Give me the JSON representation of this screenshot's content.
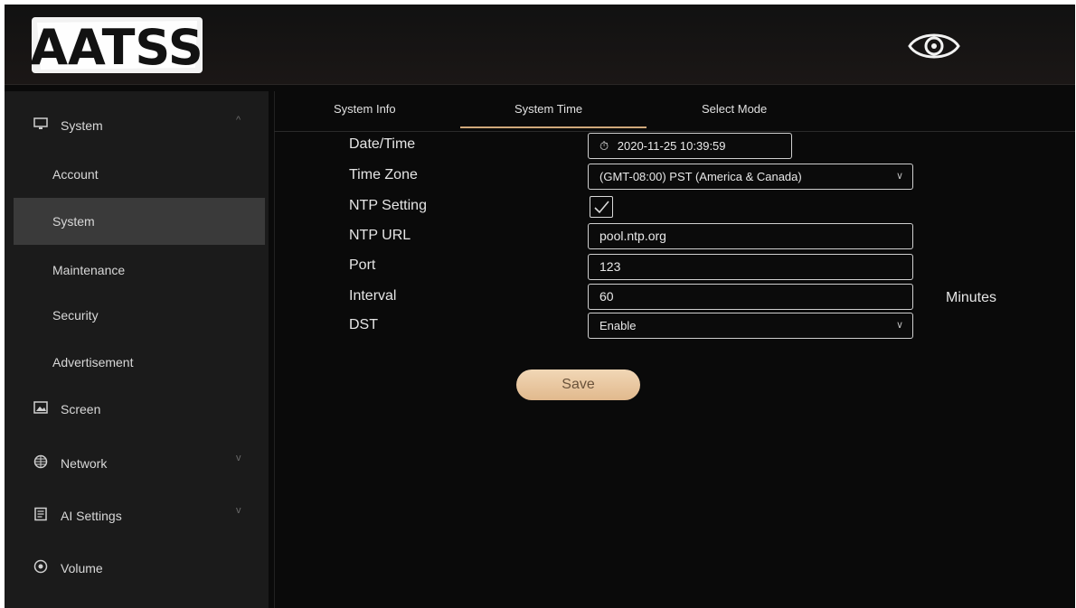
{
  "header": {
    "logo_text": "AATSS",
    "eye_icon": "eye-icon"
  },
  "sidebar": {
    "items": [
      {
        "label": "System",
        "icon": "monitor-icon",
        "chevron": "^"
      },
      {
        "label": "Account"
      },
      {
        "label": "System"
      },
      {
        "label": "Maintenance"
      },
      {
        "label": "Security"
      },
      {
        "label": "Advertisement"
      },
      {
        "label": "Screen",
        "icon": "image-icon"
      },
      {
        "label": "Network",
        "icon": "globe-icon",
        "chevron": "v"
      },
      {
        "label": "AI Settings",
        "icon": "document-icon",
        "chevron": "v"
      },
      {
        "label": "Volume",
        "icon": "speaker-icon"
      }
    ]
  },
  "tabs": [
    "System Info",
    "System Time",
    "Select Mode"
  ],
  "form": {
    "datetime_label": "Date/Time",
    "datetime_value": "2020-11-25 10:39:59",
    "timezone_label": "Time Zone",
    "timezone_value": "(GMT-08:00) PST (America & Canada)",
    "ntp_setting_label": "NTP Setting",
    "ntp_url_label": "NTP URL",
    "ntp_url_value": "pool.ntp.org",
    "port_label": "Port",
    "port_value": "123",
    "interval_label": "Interval",
    "interval_value": "60",
    "interval_unit": "Minutes",
    "dst_label": "DST",
    "dst_value": "Enable",
    "save_label": "Save"
  },
  "colors": {
    "accent": "#cfa87a",
    "save_bg": "#e8c49c"
  }
}
